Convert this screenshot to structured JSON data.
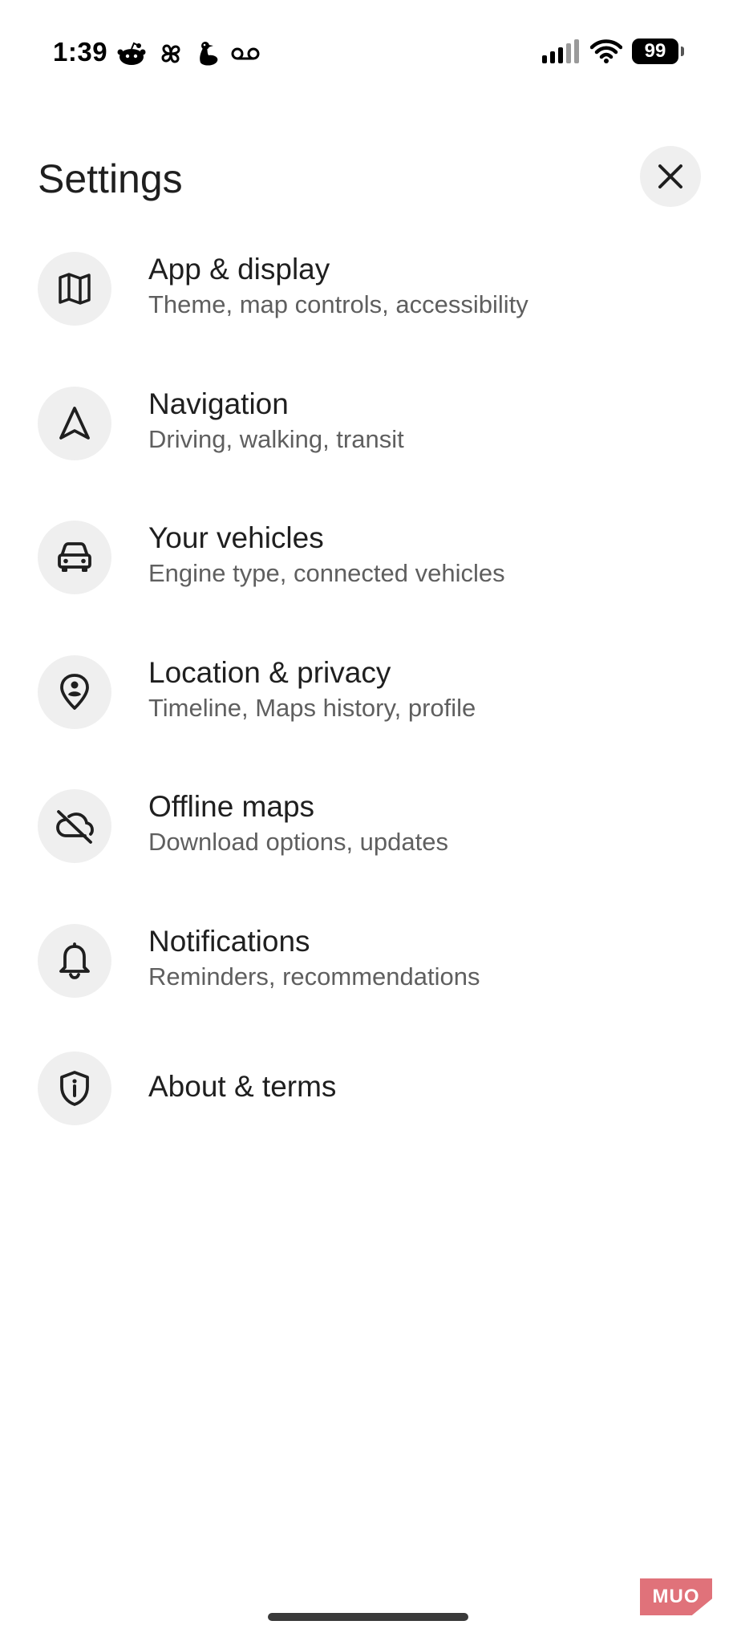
{
  "status_bar": {
    "time": "1:39",
    "battery": "99",
    "app_icons": [
      "reddit-icon",
      "pinwheel-icon",
      "goose-icon",
      "voicemail-icon"
    ],
    "signal_icon": "cellular-signal-icon",
    "wifi_icon": "wifi-icon"
  },
  "header": {
    "title": "Settings",
    "close_icon": "close-icon"
  },
  "items": [
    {
      "title": "App & display",
      "subtitle": "Theme, map controls, accessibility",
      "icon": "map-icon"
    },
    {
      "title": "Navigation",
      "subtitle": "Driving, walking, transit",
      "icon": "navigation-arrow-icon"
    },
    {
      "title": "Your vehicles",
      "subtitle": "Engine type, connected vehicles",
      "icon": "car-icon"
    },
    {
      "title": "Location & privacy",
      "subtitle": "Timeline, Maps history, profile",
      "icon": "location-person-icon"
    },
    {
      "title": "Offline maps",
      "subtitle": "Download options, updates",
      "icon": "cloud-off-icon"
    },
    {
      "title": "Notifications",
      "subtitle": "Reminders, recommendations",
      "icon": "bell-icon"
    },
    {
      "title": "About & terms",
      "subtitle": "",
      "icon": "shield-info-icon"
    }
  ],
  "watermark": "MUO",
  "colors": {
    "background": "#ffffff",
    "icon_circle": "#efefef",
    "title_text": "#1f1f1f",
    "subtitle_text": "#5f5f5f",
    "watermark_bg": "#e0727a"
  }
}
